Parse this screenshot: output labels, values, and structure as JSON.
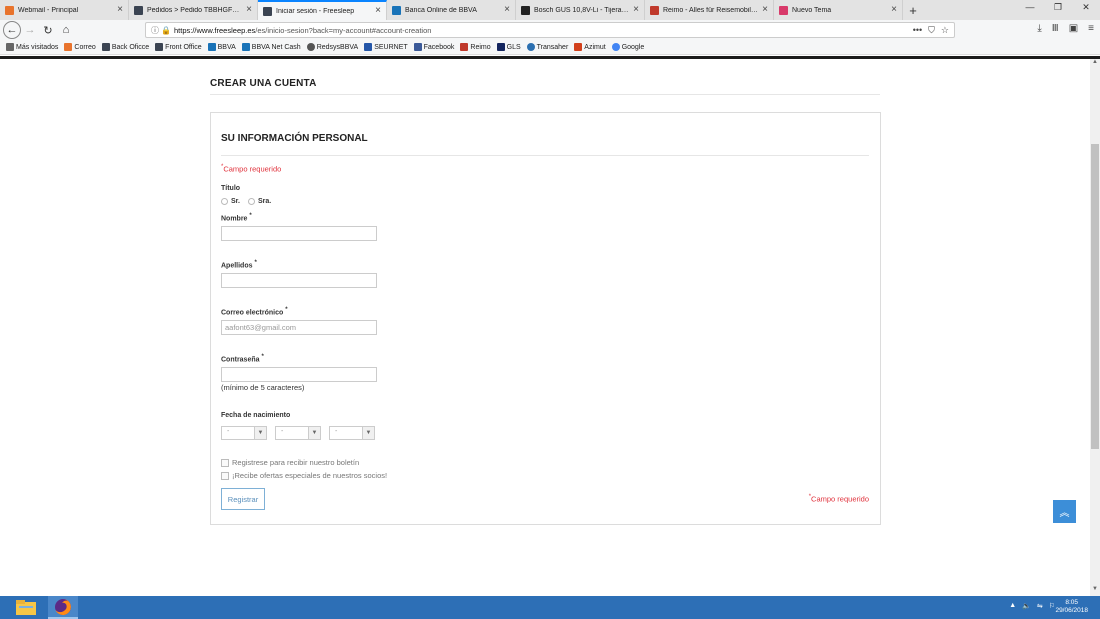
{
  "browser": {
    "tabs": [
      {
        "title": "Webmail - Principal",
        "color": "#e8732c",
        "active": false
      },
      {
        "title": "Pedidos > Pedido TBBHGFLYC",
        "color": "#3b4452",
        "active": false
      },
      {
        "title": "Iniciar sesión - Freesleep",
        "color": "#3b4452",
        "active": true
      },
      {
        "title": "Banca Online de BBVA",
        "color": "#1973b8",
        "active": false
      },
      {
        "title": "Bosch GUS 10,8V-Li - Tijera (N...",
        "color": "#222222",
        "active": false
      },
      {
        "title": "Reimo - Alles für Reisemobile,...",
        "color": "#c0392b",
        "active": false
      },
      {
        "title": "Nuevo Tema",
        "color": "#d83a6a",
        "active": false
      }
    ],
    "new_tab": "+",
    "window_controls": {
      "minimize": "—",
      "maximize": "❐",
      "close": "✕"
    },
    "url_host": "https://www.freesleep.es",
    "url_path": "/es/inicio-sesion?back=my-account#account-creation",
    "url_actions": {
      "more": "•••",
      "pocket": "⛉",
      "star": "☆"
    },
    "right_icons": {
      "download": "⤓",
      "library": "Ⅲ",
      "sidebar": "▣",
      "menu": "≡"
    },
    "bookmarks": [
      {
        "label": "Más visitados",
        "color": "#666666"
      },
      {
        "label": "Correo",
        "color": "#e8732c"
      },
      {
        "label": "Back Oficce",
        "color": "#3b4452"
      },
      {
        "label": "Front Office",
        "color": "#3b4452"
      },
      {
        "label": "BBVA",
        "color": "#1973b8"
      },
      {
        "label": "BBVA Net Cash",
        "color": "#1973b8"
      },
      {
        "label": "RedsysBBVA",
        "color": "#555555"
      },
      {
        "label": "SEURNET",
        "color": "#2456a8"
      },
      {
        "label": "Facebook",
        "color": "#3b5998"
      },
      {
        "label": "Reimo",
        "color": "#c0392b"
      },
      {
        "label": "GLS",
        "color": "#13245e"
      },
      {
        "label": "Transaher",
        "color": "#2b6fb0"
      },
      {
        "label": "Azimut",
        "color": "#d2401b"
      },
      {
        "label": "Google",
        "color": "#4285f4"
      }
    ]
  },
  "page": {
    "heading": "CREAR UNA CUENTA",
    "section_title": "SU INFORMACIÓN PERSONAL",
    "required_note": "Campo requerido",
    "required_star": "*",
    "titulo_label": "Título",
    "titulo_options": [
      "Sr.",
      "Sra."
    ],
    "nombre_label": "Nombre",
    "nombre_value": "",
    "apellidos_label": "Apellidos",
    "apellidos_value": "",
    "email_label": "Correo electrónico",
    "email_value": "aafont63@gmail.com",
    "password_label": "Contraseña",
    "password_hint": "(mínimo de 5 caracteres)",
    "birth_label": "Fecha de nacimiento",
    "birth_day": "-",
    "birth_month": "-",
    "birth_year": "-",
    "newsletter_label": "Registrese para recibir nuestro boletín",
    "offers_label": "¡Recibe ofertas especiales de nuestros socios!",
    "submit_label": "Registrar",
    "to_top": "︽"
  },
  "taskbar": {
    "clock_time": "8:05",
    "clock_date": "29/06/2018",
    "tray": [
      "▲",
      "🔈",
      "⚐"
    ]
  }
}
